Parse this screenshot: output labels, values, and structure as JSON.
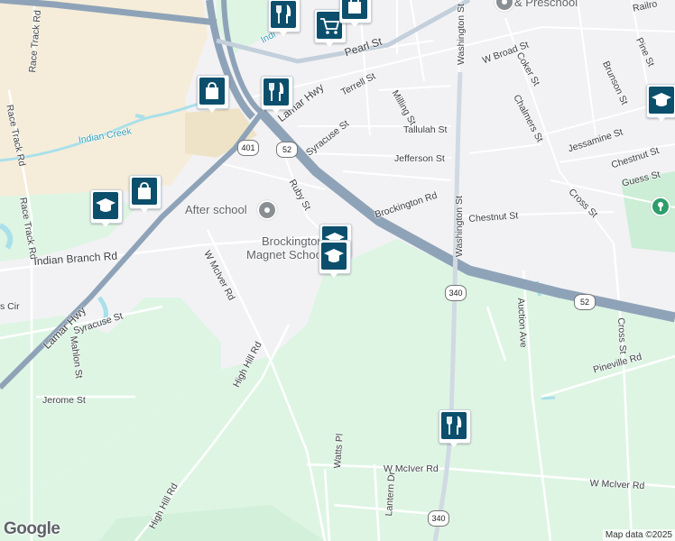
{
  "map": {
    "attribution": "Map data ©2025",
    "logo": "Google",
    "colors": {
      "background": "#f2f2f4",
      "park": "#def5e4",
      "sand": "#f6ecd6",
      "highway": "#8fa3b8",
      "water": "#a9e0ea"
    },
    "streets": {
      "pearl_st": "Pearl St",
      "terrell_st": "Terrell St",
      "lamar_hwy_top": "Lamar Hwy",
      "syracuse_st_top": "Syracuse St",
      "milling_st": "Milling St",
      "tallulah_st": "Tallulah St",
      "jefferson_st": "Jefferson St",
      "w_broad_st": "W Broad St",
      "washington_st_top": "Washington St",
      "washington_st_mid": "Washington St",
      "coker_st": "Coker St",
      "chalmers_st": "Chalmers St",
      "brunson_st": "Brunson St",
      "pine_st": "Pine St",
      "railroad": "Railro",
      "jessamine_st": "Jessamine St",
      "chestnut_st_right": "Chestnut St",
      "guess_st": "Guess St",
      "cross_st_top": "Cross St",
      "brockington_rd": "Brockington Rd",
      "chestnut_st_mid": "Chestnut St",
      "ruby_st": "Ruby St",
      "race_track_rd_1": "Race Track Rd",
      "race_track_rd_2": "Race Track Rd",
      "race_track_rd_3": "Race Track Rd",
      "indian_creek": "Indian Creek",
      "indian_creek_top": "Indi",
      "indian_branch_rd": "Indian Branch Rd",
      "w_mciver_rd_diag": "W McIver Rd",
      "syracuse_st_low": "Syracuse St",
      "s_cir": "s Cir",
      "lamar_hwy_low": "Lamar Hwy",
      "mahlon_st": "Mahlon St",
      "jerome_st": "Jerome St",
      "high_hill_rd_1": "High Hill Rd",
      "high_hill_rd_2": "High Hill Rd",
      "auction_ave": "Auction Ave",
      "cross_st_low": "Cross St",
      "pineville_rd": "Pineville Rd",
      "w_mciver_rd_1": "W McIver Rd",
      "w_mciver_rd_2": "W McIver Rd",
      "watts_pl": "Watts Pl",
      "lantern_dr": "Lantern Dr"
    },
    "shields": {
      "us401": "401",
      "us52_a": "52",
      "us52_b": "52",
      "sc340_a": "340",
      "sc340_b": "340"
    },
    "places": {
      "preschool": "& Preschool",
      "after_school": "After school",
      "brockington_line1": "Brockington",
      "brockington_line2": "Magnet School"
    },
    "markers": [
      {
        "name": "restaurant-marker-top",
        "icon": "fork-knife-icon"
      },
      {
        "name": "grocery-marker",
        "icon": "shopping-cart-icon"
      },
      {
        "name": "shopping-marker-top",
        "icon": "shopping-bag-icon"
      },
      {
        "name": "shopping-marker-lamar",
        "icon": "shopping-bag-icon"
      },
      {
        "name": "restaurant-marker-lamar",
        "icon": "fork-knife-icon"
      },
      {
        "name": "school-marker-left",
        "icon": "graduation-cap-icon"
      },
      {
        "name": "shopping-marker-left",
        "icon": "shopping-bag-icon"
      },
      {
        "name": "school-marker-brockington-a",
        "icon": "graduation-cap-icon"
      },
      {
        "name": "school-marker-brockington-b",
        "icon": "graduation-cap-icon"
      },
      {
        "name": "school-marker-right",
        "icon": "graduation-cap-icon"
      },
      {
        "name": "restaurant-marker-south",
        "icon": "fork-knife-icon"
      }
    ]
  }
}
